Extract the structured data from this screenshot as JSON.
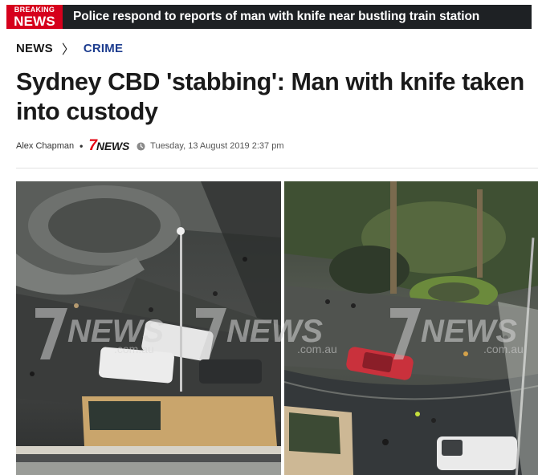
{
  "breaking": {
    "badge_top": "BREAKING",
    "badge_bottom": "NEWS",
    "text": "Police respond to reports of man with knife near bustling train station"
  },
  "breadcrumb": {
    "section": "NEWS",
    "separator": "〉",
    "subsection": "CRIME"
  },
  "article": {
    "headline": "Sydney CBD 'stabbing': Man with knife taken into custody",
    "author": "Alex Chapman",
    "byline_separator": "•",
    "logo_seven": "7",
    "logo_news": "NEWS",
    "date": "Tuesday, 13 August 2019 2:37 pm"
  },
  "image": {
    "watermark_brand": "NEWS",
    "watermark_domain": ".com.au",
    "description_icon": "photo"
  },
  "colors": {
    "breaking_red": "#d6001c",
    "bar_dark": "#1e2124",
    "crime_blue": "#1d3d8f",
    "logo_red": "#e30613"
  }
}
